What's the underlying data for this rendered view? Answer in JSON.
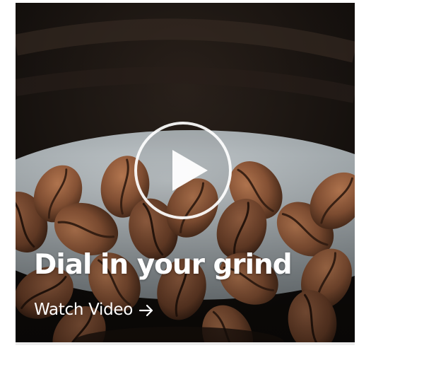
{
  "card": {
    "title": "Dial in your grind",
    "link_label": "Watch Video",
    "media_subject": "coffee beans in a grinder",
    "icons": {
      "play": "play-icon",
      "arrow": "arrow-right-icon"
    },
    "colors": {
      "text": "#ffffff",
      "bean": "#8a5738",
      "background": "#1a1410",
      "bowl": "#a9b1b6"
    }
  }
}
